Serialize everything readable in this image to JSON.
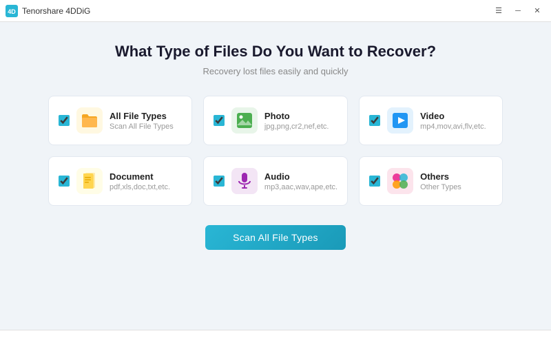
{
  "titlebar": {
    "app_name": "Tenorshare 4DDiG",
    "controls": {
      "menu_label": "☰",
      "minimize_label": "─",
      "close_label": "✕"
    }
  },
  "page": {
    "heading": "What Type of Files Do You Want to Recover?",
    "subheading": "Recovery lost files easily and quickly"
  },
  "cards": [
    {
      "id": "all-file-types",
      "title": "All File Types",
      "desc": "Scan All File Types",
      "checked": true,
      "icon_type": "folder",
      "icon_color": "#f5a623"
    },
    {
      "id": "photo",
      "title": "Photo",
      "desc": "jpg,png,cr2,nef,etc.",
      "checked": true,
      "icon_type": "photo",
      "icon_color": "#4caf50"
    },
    {
      "id": "video",
      "title": "Video",
      "desc": "mp4,mov,avi,flv,etc.",
      "checked": true,
      "icon_type": "video",
      "icon_color": "#2196f3"
    },
    {
      "id": "document",
      "title": "Document",
      "desc": "pdf,xls,doc,txt,etc.",
      "checked": true,
      "icon_type": "document",
      "icon_color": "#ffb300"
    },
    {
      "id": "audio",
      "title": "Audio",
      "desc": "mp3,aac,wav,ape,etc.",
      "checked": true,
      "icon_type": "audio",
      "icon_color": "#9c27b0"
    },
    {
      "id": "others",
      "title": "Others",
      "desc": "Other Types",
      "checked": true,
      "icon_type": "others",
      "icon_color": "#e91e8c"
    }
  ],
  "scan_button": {
    "label": "Scan All File Types"
  }
}
